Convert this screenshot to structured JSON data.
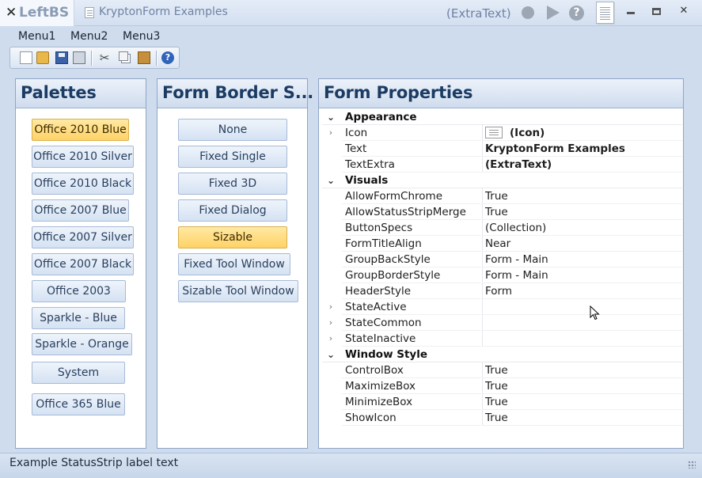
{
  "titlebar": {
    "left_button_label": "LeftBS",
    "left_button_glyph": "✕",
    "title": "KryptonForm Examples",
    "extra_text": "(ExtraText)",
    "icons": [
      "close-x-icon",
      "app-document-icon",
      "record-icon",
      "play-icon",
      "help-icon",
      "document-icon",
      "minimize-icon",
      "maximize-icon",
      "close-icon"
    ],
    "close_glyph": "✕",
    "help_glyph": "?"
  },
  "menubar": {
    "items": [
      "Menu1",
      "Menu2",
      "Menu3"
    ]
  },
  "toolbar": {
    "icons": [
      "new-icon",
      "open-icon",
      "save-icon",
      "print-icon",
      "cut-icon",
      "copy-icon",
      "paste-icon",
      "help-icon"
    ],
    "cut_glyph": "✂",
    "help_glyph": "?"
  },
  "palettes": {
    "title": "Palettes",
    "selected": "Office 2010 Blue",
    "items": [
      "Office 2010 Blue",
      "Office 2010 Silver",
      "Office 2010 Black",
      "Office 2007 Blue",
      "Office 2007 Silver",
      "Office 2007 Black",
      "Office 2003",
      "Sparkle - Blue",
      "Sparkle - Orange",
      "System",
      "Office 365 Blue"
    ]
  },
  "border_styles": {
    "title": "Form  Border S...",
    "selected": "Sizable",
    "items": [
      "None",
      "Fixed Single",
      "Fixed 3D",
      "Fixed Dialog",
      "Sizable",
      "Fixed Tool Window",
      "Sizable Tool Window"
    ]
  },
  "properties": {
    "title": "Form Properties",
    "expand_glyph": "›",
    "collapse_glyph": "⌄",
    "categories": [
      {
        "name": "Appearance",
        "rows": [
          {
            "name": "Icon",
            "value": "(Icon)",
            "bold": true,
            "expandable": true,
            "has_icon": true
          },
          {
            "name": "Text",
            "value": "KryptonForm Examples",
            "bold": true,
            "expandable": false
          },
          {
            "name": "TextExtra",
            "value": "(ExtraText)",
            "bold": true,
            "expandable": false
          }
        ]
      },
      {
        "name": "Visuals",
        "rows": [
          {
            "name": "AllowFormChrome",
            "value": "True"
          },
          {
            "name": "AllowStatusStripMerge",
            "value": "True"
          },
          {
            "name": "ButtonSpecs",
            "value": "(Collection)"
          },
          {
            "name": "FormTitleAlign",
            "value": "Near"
          },
          {
            "name": "GroupBackStyle",
            "value": "Form - Main"
          },
          {
            "name": "GroupBorderStyle",
            "value": "Form - Main"
          },
          {
            "name": "HeaderStyle",
            "value": "Form"
          },
          {
            "name": "StateActive",
            "value": "",
            "expandable": true
          },
          {
            "name": "StateCommon",
            "value": "",
            "expandable": true
          },
          {
            "name": "StateInactive",
            "value": "",
            "expandable": true
          }
        ]
      },
      {
        "name": "Window Style",
        "rows": [
          {
            "name": "ControlBox",
            "value": "True"
          },
          {
            "name": "MaximizeBox",
            "value": "True"
          },
          {
            "name": "MinimizeBox",
            "value": "True"
          },
          {
            "name": "ShowIcon",
            "value": "True"
          }
        ]
      }
    ]
  },
  "statusbar": {
    "label": "Example StatusStrip label text"
  },
  "colors": {
    "frame": "#cfdcee",
    "header_text": "#1b3b63",
    "selected_button": "#ffd266",
    "button": "#d5e2f3"
  }
}
